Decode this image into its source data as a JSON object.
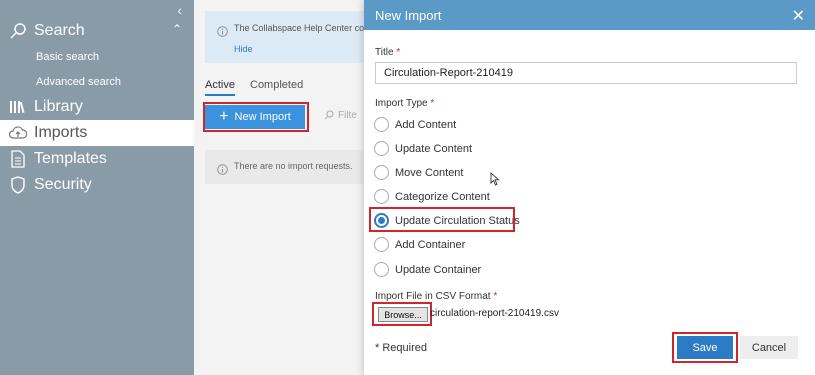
{
  "sidebar": {
    "items": [
      {
        "label": "Search",
        "icon": "search-icon"
      },
      {
        "label": "Library",
        "icon": "library-icon"
      },
      {
        "label": "Imports",
        "icon": "cloud-upload-icon"
      },
      {
        "label": "Templates",
        "icon": "document-icon"
      },
      {
        "label": "Security",
        "icon": "shield-icon"
      }
    ],
    "search_sub": [
      "Basic search",
      "Advanced search"
    ]
  },
  "main": {
    "banner_text": "The Collabspace Help Center con",
    "banner_hide": "Hide",
    "tabs": [
      "Active",
      "Completed"
    ],
    "new_import_label": "New Import",
    "filter_placeholder": "Filte",
    "empty_text": "There are no import requests."
  },
  "dialog": {
    "title": "New Import",
    "title_label": "Title",
    "title_value": "Circulation-Report-210419",
    "import_type_label": "Import Type",
    "options": [
      "Add Content",
      "Update Content",
      "Move Content",
      "Categorize Content",
      "Update Circulation Status",
      "Add Container",
      "Update Container"
    ],
    "selected_option": "Update Circulation Status",
    "file_label": "Import File in CSV Format",
    "browse_label": "Browse...",
    "file_name": "circulation-report-210419.csv",
    "required_note": "* Required",
    "save_label": "Save",
    "cancel_label": "Cancel"
  },
  "colors": {
    "sidebar": "#8a9ba8",
    "accent": "#2b7cc4",
    "header": "#5b99c7",
    "highlight": "#d0262b"
  }
}
